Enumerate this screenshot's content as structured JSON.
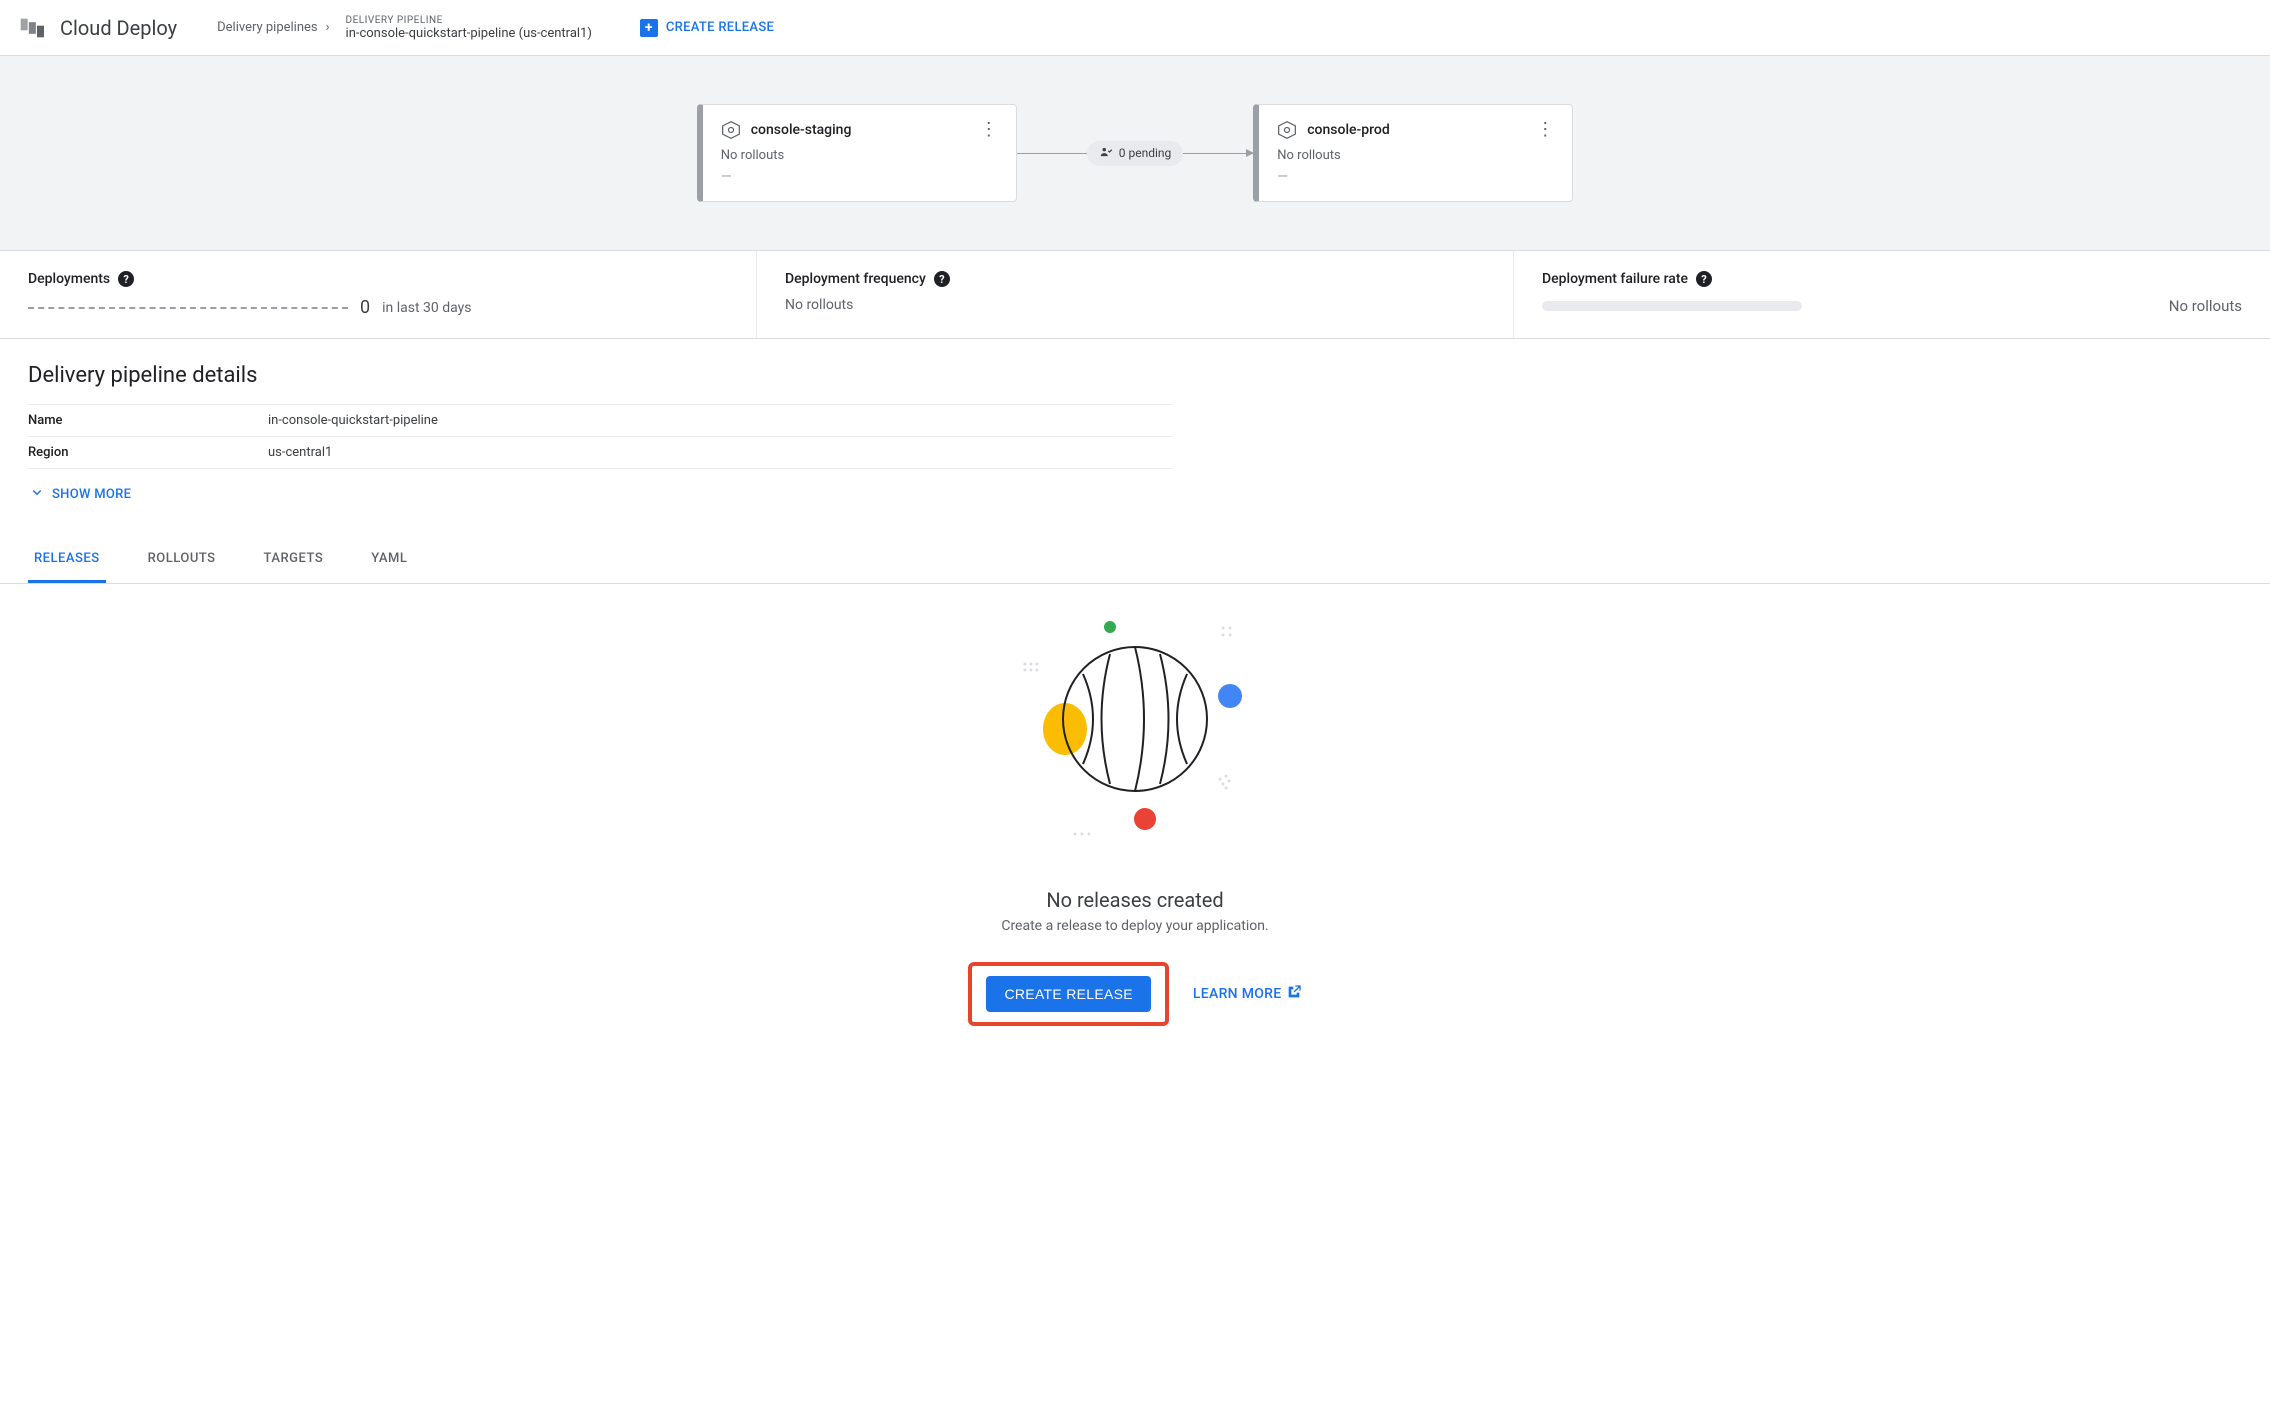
{
  "header": {
    "product": "Cloud Deploy",
    "breadcrumb_parent": "Delivery pipelines",
    "breadcrumb_eyebrow": "DELIVERY PIPELINE",
    "breadcrumb_title": "in-console-quickstart-pipeline (us-central1)",
    "create_release": "CREATE RELEASE"
  },
  "pipeline": {
    "targets": [
      {
        "name": "console-staging",
        "status": "No rollouts",
        "value": "—"
      },
      {
        "name": "console-prod",
        "status": "No rollouts",
        "value": "—"
      }
    ],
    "connector_pending": "0 pending"
  },
  "stats": {
    "deployments_label": "Deployments",
    "deployments_count": "0",
    "deployments_period": "in last 30 days",
    "frequency_label": "Deployment frequency",
    "frequency_value": "No rollouts",
    "failure_label": "Deployment failure rate",
    "failure_value": "No rollouts"
  },
  "details": {
    "heading": "Delivery pipeline details",
    "rows": [
      {
        "k": "Name",
        "v": "in-console-quickstart-pipeline"
      },
      {
        "k": "Region",
        "v": "us-central1"
      }
    ],
    "show_more": "SHOW MORE"
  },
  "tabs": [
    "RELEASES",
    "ROLLOUTS",
    "TARGETS",
    "YAML"
  ],
  "empty": {
    "title": "No releases created",
    "sub": "Create a release to deploy your application.",
    "primary": "CREATE RELEASE",
    "learn": "LEARN MORE"
  }
}
